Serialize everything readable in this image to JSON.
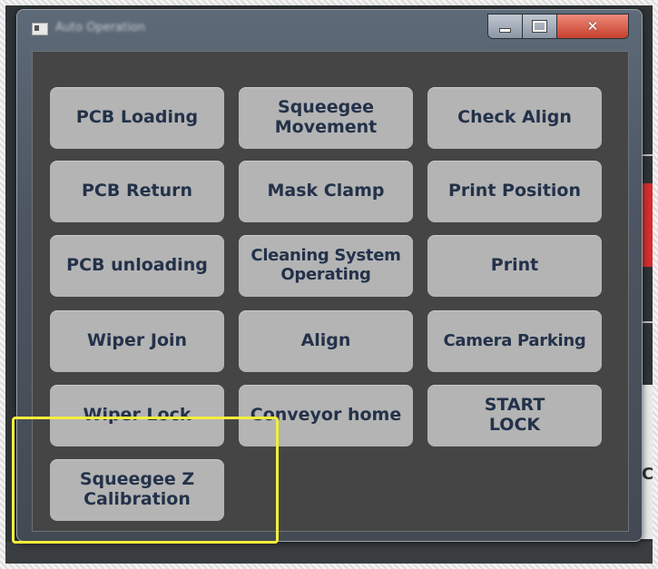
{
  "window": {
    "title": "Auto Operation",
    "close_glyph": "✕",
    "icons": {
      "app": "app-window-icon",
      "minimize": "minimize-icon",
      "maximize": "maximize-icon",
      "close": "close-icon"
    }
  },
  "buttons": {
    "pcb_loading": "PCB Loading",
    "squeegee_movement": "Squeegee\nMovement",
    "check_align": "Check Align",
    "pcb_return": "PCB Return",
    "mask_clamp": "Mask Clamp",
    "print_position": "Print Position",
    "pcb_unloading": "PCB unloading",
    "cleaning_system_operating": "Cleaning System\nOperating",
    "print": "Print",
    "wiper_join": "Wiper Join",
    "align": "Align",
    "camera_parking": "Camera Parking",
    "wiper_lock": "Wiper Lock",
    "conveyor_home": "Conveyor home",
    "start_lock": "START\nLOCK",
    "squeegee_z_calibration": "Squeegee Z\nCalibration"
  },
  "background": {
    "edge_text": "C"
  },
  "colors": {
    "button_bg": "#b4b4b4",
    "button_text": "#23324a",
    "highlight": "#f2ee3c"
  }
}
